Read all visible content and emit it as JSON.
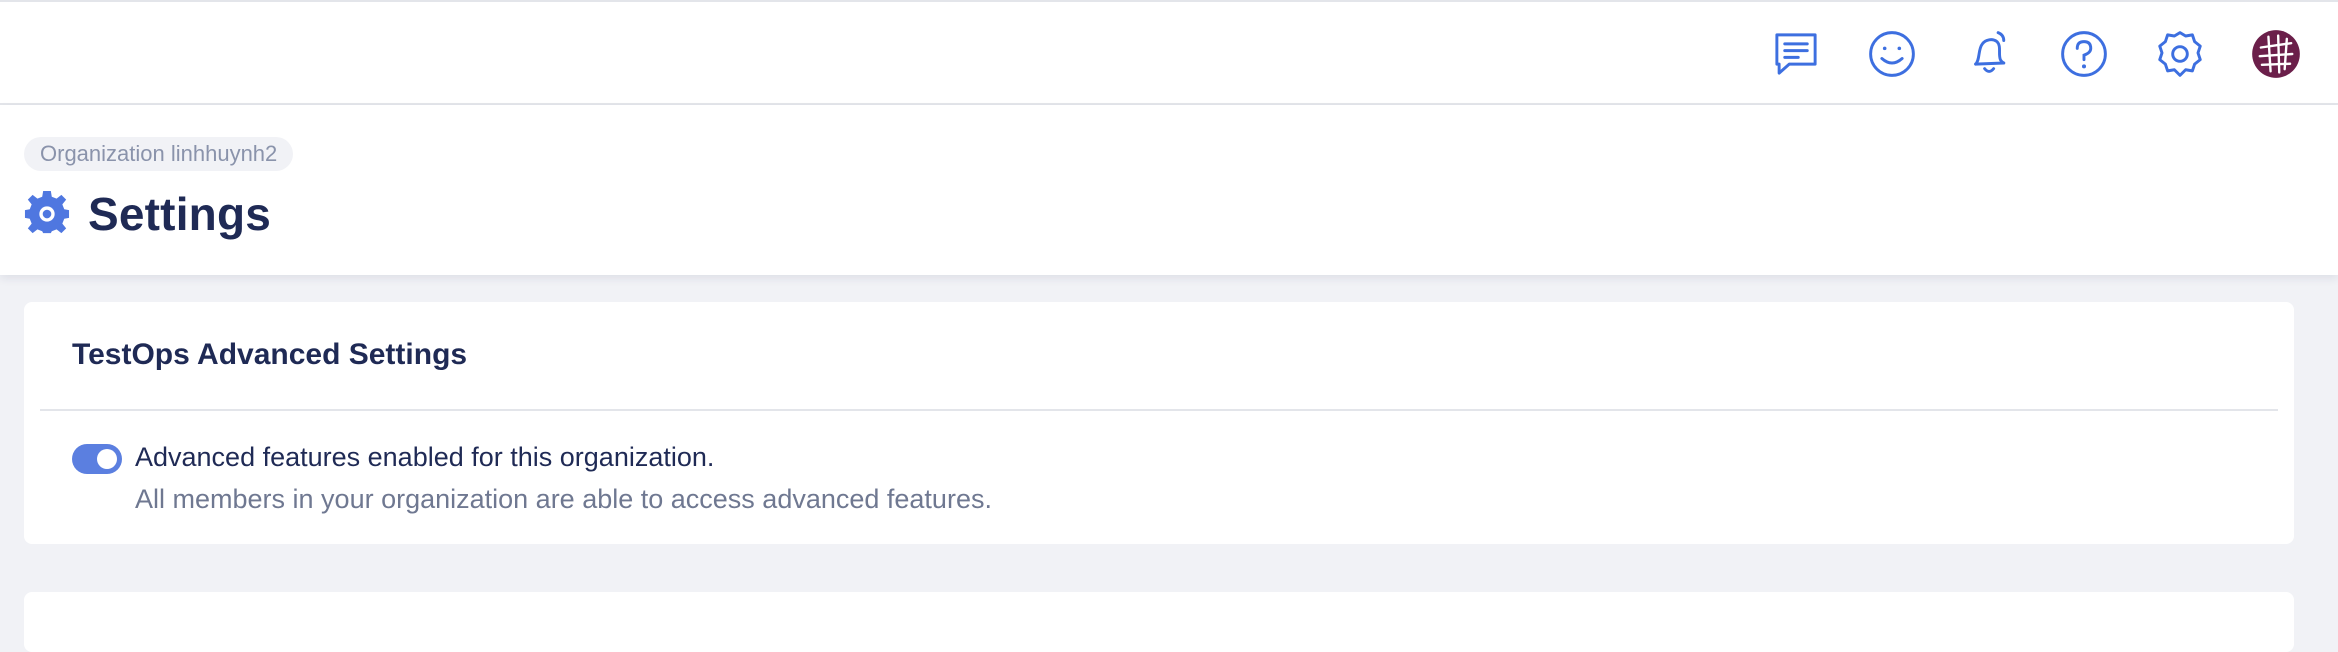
{
  "header": {
    "icons": [
      {
        "name": "chat-icon"
      },
      {
        "name": "smiley-icon"
      },
      {
        "name": "bell-icon"
      },
      {
        "name": "help-icon"
      },
      {
        "name": "gear-icon"
      },
      {
        "name": "avatar"
      }
    ]
  },
  "page": {
    "breadcrumb": "Organization linhhuynh2",
    "title": "Settings",
    "title_icon": "gear-icon"
  },
  "advanced_settings": {
    "title": "TestOps Advanced Settings",
    "toggle_on": true,
    "feature_label": "Advanced features enabled for this organization.",
    "feature_description": "All members in your organization are able to access advanced features."
  },
  "colors": {
    "accent": "#5b7fe0",
    "icon_blue": "#3d6fe0",
    "title_text": "#1f2a55",
    "muted_text": "#6f7891",
    "avatar": "#6b1f4a"
  }
}
